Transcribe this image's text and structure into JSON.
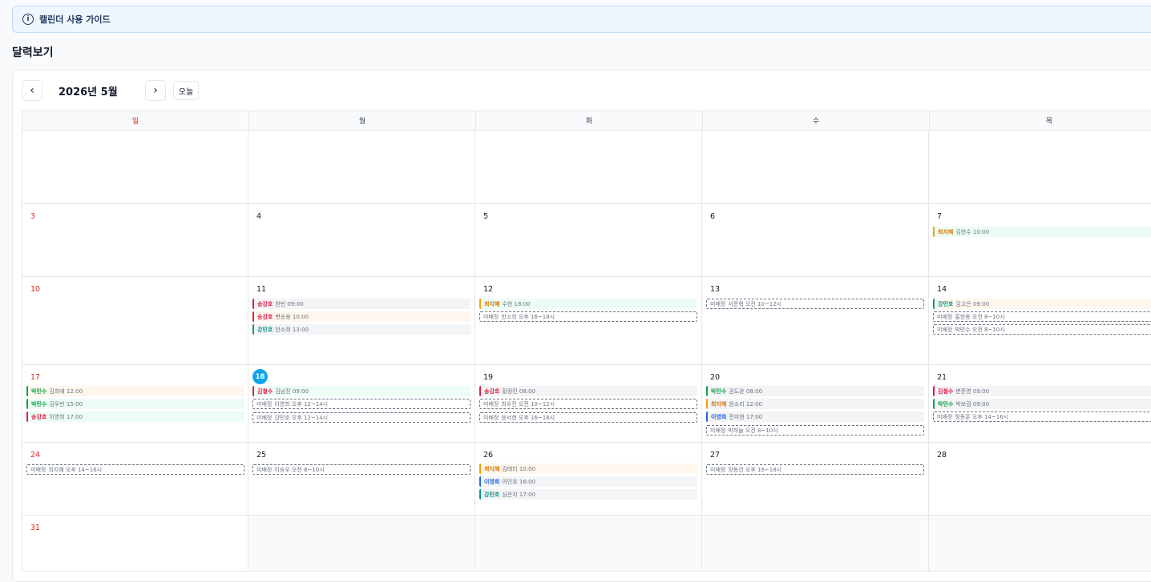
{
  "guide": {
    "info_icon": "info-icon",
    "label": "캘린더 사용 가이드"
  },
  "page_title": "달력보기",
  "toolbar": {
    "prev_icon": "chevron-left-icon",
    "next_icon": "chevron-right-icon",
    "month_label": "2026년 5월",
    "today_label": "오늘"
  },
  "weekdays": [
    "일",
    "월",
    "화",
    "수",
    "목"
  ],
  "colors": {
    "sunday": "#dc2626",
    "today_badge": "#0ea5e9",
    "grid": "#e5e7eb"
  },
  "days": {
    "3": "3",
    "4": "4",
    "5": "5",
    "6": "6",
    "7": "7",
    "10": "10",
    "11": "11",
    "12": "12",
    "13": "13",
    "14": "14",
    "17": "17",
    "18": "18",
    "19": "19",
    "20": "20",
    "21": "21",
    "24": "24",
    "25": "25",
    "26": "26",
    "27": "27",
    "28": "28",
    "31": "31"
  },
  "events": {
    "d7_0": {
      "name": "최지혜",
      "detail": "김현수 10:00"
    },
    "d11_0": {
      "name": "송강호",
      "detail": "한빈 09:00"
    },
    "d11_1": {
      "name": "송강호",
      "detail": "변승용 10:00"
    },
    "d11_2": {
      "name": "강민호",
      "detail": "안소희 13:00"
    },
    "d12_0": {
      "name": "최지혜",
      "detail": "수현 18:00"
    },
    "d12_1": {
      "name": "미배정",
      "detail": "한소희 오후 16~18시"
    },
    "d13_0": {
      "name": "미배정",
      "detail": "서준혁 오전 10~12시"
    },
    "d14_0": {
      "name": "강민호",
      "detail": "김고은 09:00"
    },
    "d14_1": {
      "name": "미배정",
      "detail": "홍현동 오전 8~10시"
    },
    "d14_2": {
      "name": "미배정",
      "detail": "박민수 오전 8~10시"
    },
    "d17_0": {
      "name": "박민수",
      "detail": "김희애 12:00"
    },
    "d17_1": {
      "name": "박민수",
      "detail": "김우빈 15:00"
    },
    "d17_2": {
      "name": "송강호",
      "detail": "이영희 17:00"
    },
    "d18_0": {
      "name": "김철수",
      "detail": "김남진 09:00"
    },
    "d18_1": {
      "name": "미배정",
      "detail": "이영희 오후 12~14시"
    },
    "d18_2": {
      "name": "미배정",
      "detail": "강민호 오후 12~14시"
    },
    "d19_0": {
      "name": "송강호",
      "detail": "황정민 08:00"
    },
    "d19_1": {
      "name": "미배정",
      "detail": "최우진 오전 10~12시"
    },
    "d19_2": {
      "name": "미배정",
      "detail": "윤서현 오후 16~18시"
    },
    "d20_0": {
      "name": "박민수",
      "detail": "권도윤 08:00"
    },
    "d20_1": {
      "name": "최지혜",
      "detail": "윤소리 12:00"
    },
    "d20_2": {
      "name": "이영희",
      "detail": "전지현 17:00"
    },
    "d20_3": {
      "name": "미배정",
      "detail": "박하늘 오전 8~10시"
    },
    "d21_0": {
      "name": "김철수",
      "detail": "변준영 09:00"
    },
    "d21_1": {
      "name": "박민수",
      "detail": "박보검 09:00"
    },
    "d21_2": {
      "name": "미배정",
      "detail": "정동훈 오후 14~16시"
    },
    "d24_0": {
      "name": "미배정",
      "detail": "최지혜 오후 14~16시"
    },
    "d25_0": {
      "name": "미배정",
      "detail": "이승우 오전 8~10시"
    },
    "d26_0": {
      "name": "최지혜",
      "detail": "김태리 10:00"
    },
    "d26_1": {
      "name": "이영희",
      "detail": "이민호 16:00"
    },
    "d26_2": {
      "name": "강민호",
      "detail": "심은지 17:00"
    },
    "d27_0": {
      "name": "미배정",
      "detail": "장동건 오후 16~18시"
    }
  }
}
